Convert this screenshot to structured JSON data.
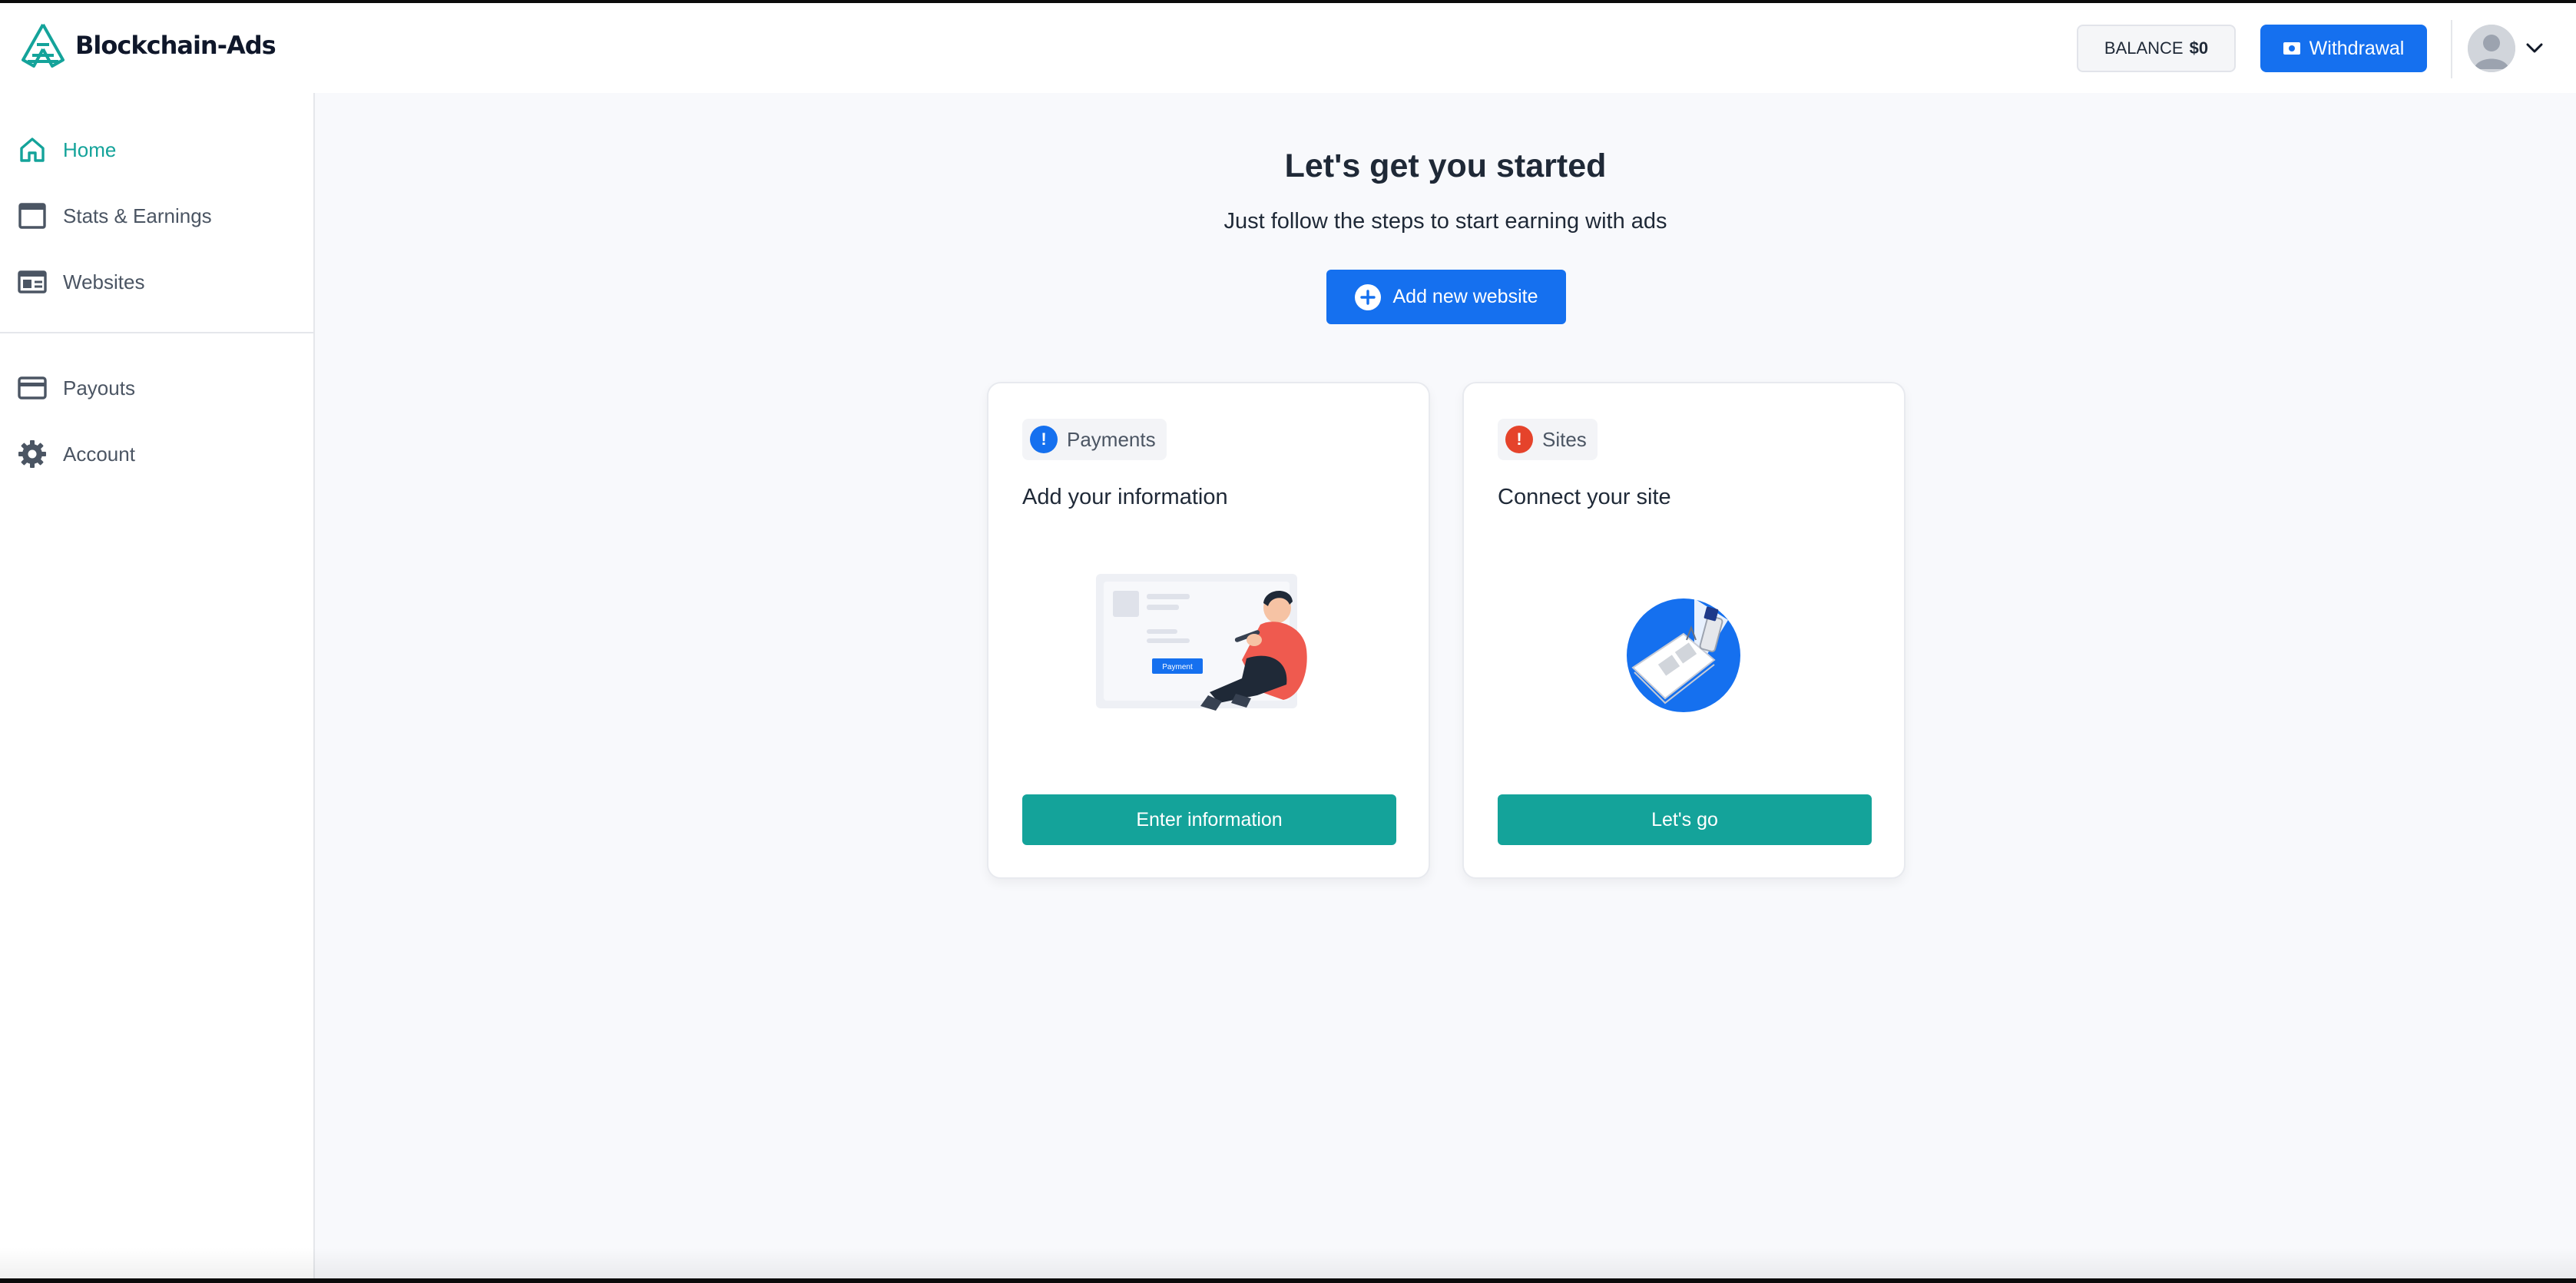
{
  "header": {
    "logo_text": "Blockchain-Ads",
    "balance_label": "BALANCE",
    "balance_value": "$0",
    "withdraw_label": "Withdrawal",
    "logo_icon": "blockchain-ads-logo-icon",
    "withdraw_icon": "cash-icon",
    "avatar_icon": "user-avatar-icon",
    "menu_icon": "chevron-down-icon"
  },
  "sidebar": {
    "items": [
      {
        "label": "Home",
        "icon": "home-icon",
        "active": true
      },
      {
        "label": "Stats & Earnings",
        "icon": "window-icon",
        "active": false
      },
      {
        "label": "Websites",
        "icon": "browser-icon",
        "active": false
      },
      {
        "label": "Payouts",
        "icon": "credit-card-icon",
        "active": false
      },
      {
        "label": "Account",
        "icon": "gear-icon",
        "active": false
      }
    ]
  },
  "main": {
    "title": "Let's get you started",
    "subtitle": "Just follow the steps to start earning with ads",
    "add_button": "Add new website",
    "add_icon": "plus-circle-icon"
  },
  "cards": [
    {
      "tag": "Payments",
      "tag_color": "#1570ef",
      "heading": "Add your information",
      "illustration_label": "Payment",
      "button": "Enter information"
    },
    {
      "tag": "Sites",
      "tag_color": "#e5432b",
      "heading": "Connect your site",
      "button": "Let's go"
    }
  ],
  "colors": {
    "primary_blue": "#1570ef",
    "teal": "#14a39a",
    "alert_red": "#e5432b",
    "page_bg": "#f8f9fc"
  }
}
